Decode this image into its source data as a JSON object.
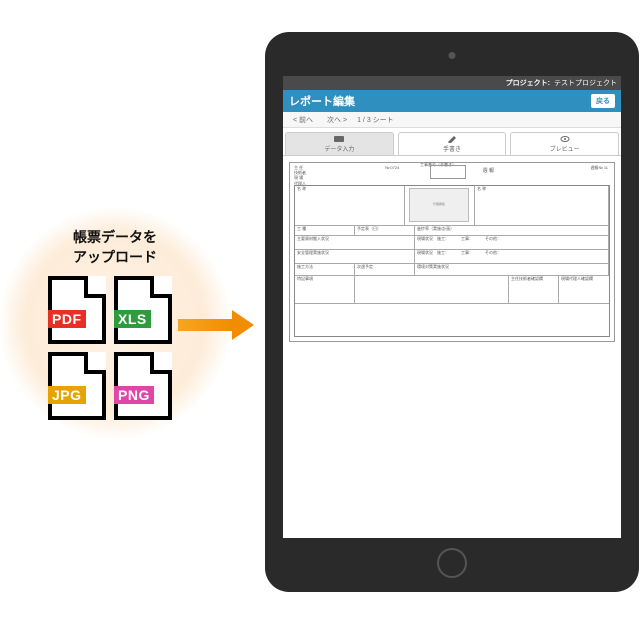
{
  "caption_line1": "帳票データを",
  "caption_line2": "アップロード",
  "file_types": {
    "pdf": "PDF",
    "xls": "XLS",
    "jpg": "JPG",
    "png": "PNG"
  },
  "topbar": {
    "project_label": "プロジェクト:",
    "project_name": "テストプロジェクト"
  },
  "titlebar": {
    "title": "レポート編集",
    "back": "戻る"
  },
  "nav": {
    "prev": "< 前へ",
    "next": "次へ >",
    "sheet": "1 / 3 シート"
  },
  "tabs": {
    "t1": "データ入力",
    "t2": "手書き",
    "t3": "プレビュー"
  },
  "sheet": {
    "hdr_lines": "主 任\n技術者\n現 場\n代理人",
    "hdr2": "№  0724",
    "code_label": "工事番号（手書き）",
    "title": "週    報",
    "page": "週報№ 11",
    "photozone": "代理看板",
    "topcells": [
      "名   称",
      "名   称"
    ],
    "row_work": "工   種",
    "row_schedule": "予定表（日）",
    "row_progress": "進捗率（実施/計画）",
    "row_material": "主要資材搬入状況",
    "row_safety": "安全管理実施状況",
    "row_special": "特記事項",
    "row_method": "施工方法",
    "row_next": "次週予定",
    "row_env": "環境対策実施状況",
    "sample_text": "現場状況　施工：　　　工事：　　　その他：",
    "footer1": "主任技術者確認欄",
    "footer2": "現場代理人確認欄"
  }
}
